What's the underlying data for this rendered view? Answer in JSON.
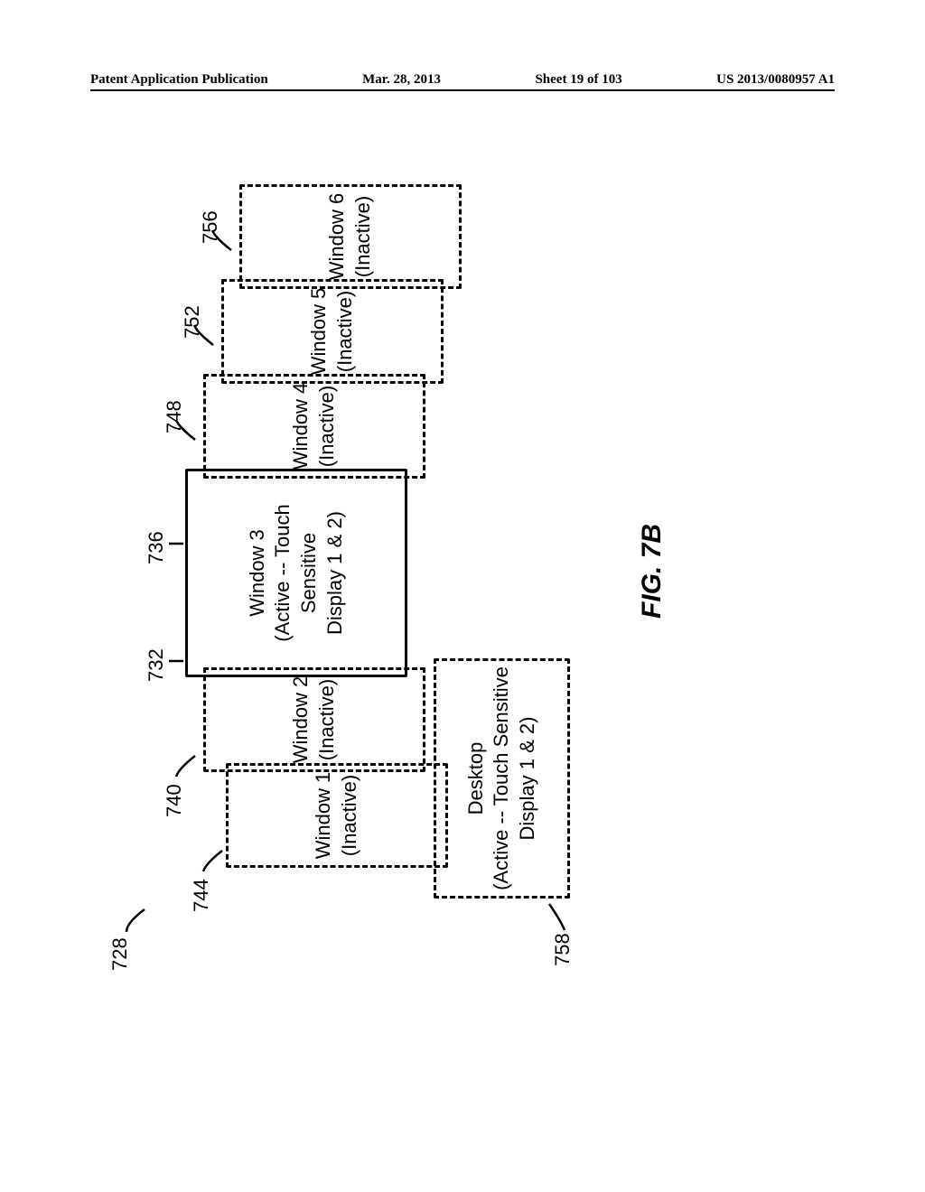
{
  "header": {
    "pub_type": "Patent Application Publication",
    "date": "Mar. 28, 2013",
    "sheet": "Sheet 19 of 103",
    "pub_number": "US 2013/0080957 A1"
  },
  "diagram": {
    "group_ref": "728",
    "boxes": {
      "window1": {
        "ref": "744",
        "line1": "Window 1",
        "line2": "(Inactive)"
      },
      "window2": {
        "ref": "740",
        "line1": "Window 2",
        "line2": "(Inactive)"
      },
      "window3_left_ref": "732",
      "window3_right_ref": "736",
      "window3": {
        "line1": "Window 3",
        "line2": "(Active -- Touch Sensitive",
        "line3": "Display 1 & 2)"
      },
      "window4": {
        "ref": "748",
        "line1": "Window 4",
        "line2": "(Inactive)"
      },
      "window5": {
        "ref": "752",
        "line1": "Window 5",
        "line2": "(Inactive)"
      },
      "window6": {
        "ref": "756",
        "line1": "Window 6",
        "line2": "(Inactive)"
      },
      "desktop": {
        "ref": "758",
        "line1": "Desktop",
        "line2": "(Active -- Touch Sensitive",
        "line3": "Display 1 & 2)"
      }
    },
    "figure_label": "FIG. 7B"
  }
}
